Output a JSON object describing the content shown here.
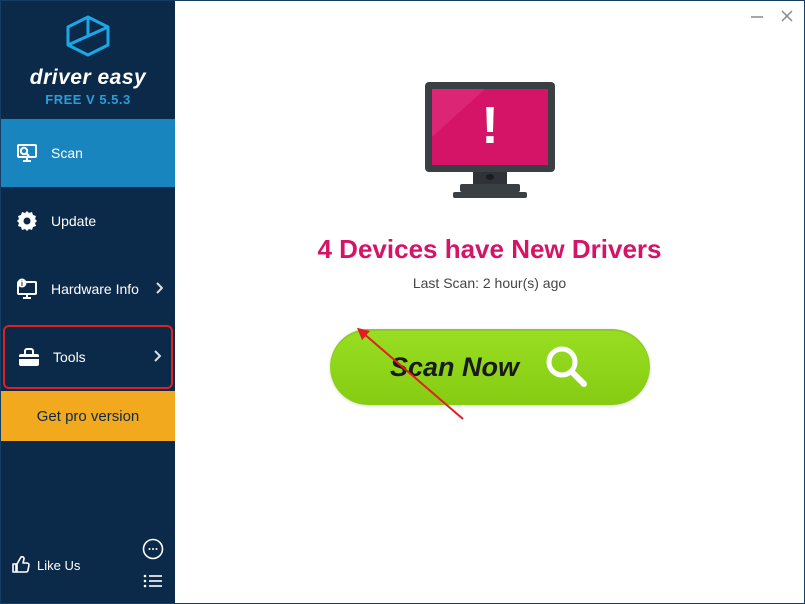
{
  "brand": {
    "name": "driver easy",
    "version": "FREE V 5.5.3"
  },
  "sidebar": {
    "items": [
      {
        "label": "Scan"
      },
      {
        "label": "Update"
      },
      {
        "label": "Hardware Info"
      },
      {
        "label": "Tools"
      }
    ],
    "pro_label": "Get pro version",
    "likeus_label": "Like Us"
  },
  "main": {
    "headline": "4 Devices have New Drivers",
    "last_scan": "Last Scan: 2 hour(s) ago",
    "scan_button_label": "Scan Now"
  }
}
